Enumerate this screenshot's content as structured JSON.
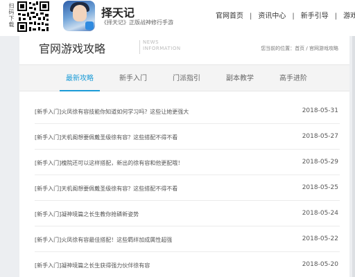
{
  "header": {
    "qr_label": "扫码下载",
    "app_name": "择天记",
    "app_desc": "《择天记》正版战神修行手游",
    "nav": [
      "官网首页",
      "资讯中心",
      "新手引导",
      "游戏"
    ]
  },
  "panel": {
    "title": "官网游戏攻略",
    "title_en_1": "NEWS",
    "title_en_2": "INFORMATION",
    "breadcrumb_prefix": "您当前的位置：",
    "breadcrumb_home": "首页",
    "breadcrumb_sep": " / ",
    "breadcrumb_current": "官网游戏攻略"
  },
  "tabs": [
    "最新攻略",
    "新手入门",
    "门派指引",
    "副本教学",
    "高手进阶"
  ],
  "active_tab": 0,
  "articles": [
    {
      "title": "[新手入门]火凤徐有容技能你知道如何学习吗？这些让她更强大",
      "date": "2018-05-31"
    },
    {
      "title": "[新手入门]天机阁想要佩戴圣级徐有容？这些搭配不得不看",
      "date": "2018-05-27"
    },
    {
      "title": "[新手入门]槐院还可以这样搭配，新出的徐有容和他更配哦！",
      "date": "2018-05-29"
    },
    {
      "title": "[新手入门]天机阁想要佩戴圣级徐有容？这些搭配不得不看",
      "date": "2018-05-25"
    },
    {
      "title": "[新手入门]凝神境篇之长生教你抢磷新姿势",
      "date": "2018-05-24"
    },
    {
      "title": "[新手入门]火凤徐有容最佳搭配！这些羁绊加成属性超强",
      "date": "2018-05-22"
    },
    {
      "title": "[新手入门]凝神境篇之长生获得强力伙伴徐有容",
      "date": "2018-05-20"
    }
  ],
  "colors": {
    "accent": "#1a9bd7",
    "background": "#eceef1"
  },
  "icons": {
    "qr": "qr-code-icon",
    "app": "app-icon"
  }
}
